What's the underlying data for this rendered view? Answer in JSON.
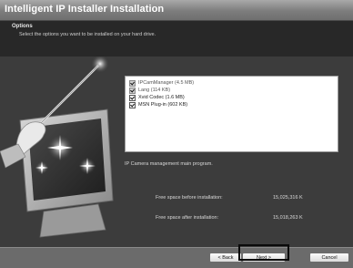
{
  "window": {
    "title": "Intelligent IP Installer Installation"
  },
  "header": {
    "title": "Options",
    "description": "Select the options you want to be installed on your hard drive."
  },
  "options": {
    "items": [
      {
        "label": "IPCamManager (4.5 MB)",
        "checked": true,
        "disabled": true
      },
      {
        "label": "Lang (114 KB)",
        "checked": true,
        "disabled": true
      },
      {
        "label": "Xvid Codec (1.6 MB)",
        "checked": true,
        "disabled": false
      },
      {
        "label": "MSN Plug-in (602 KB)",
        "checked": true,
        "disabled": false
      }
    ]
  },
  "selection_description": "IP Camera management main program.",
  "disk_space": {
    "before_label": "Free space before installation:",
    "before_value": "15,025,316 K",
    "after_label": "Free space after installation:",
    "after_value": "15,018,263 K"
  },
  "buttons": {
    "back": "< Back",
    "next": "Next >",
    "cancel": "Cancel"
  }
}
